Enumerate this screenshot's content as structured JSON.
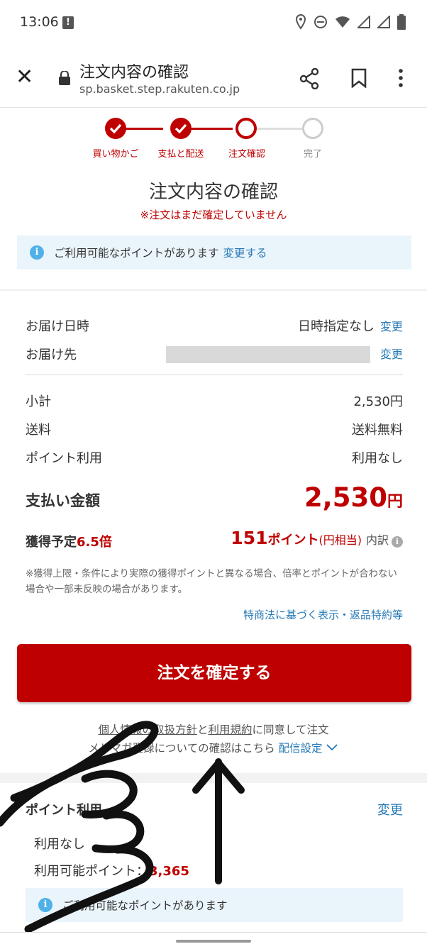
{
  "status_bar": {
    "time": "13:06"
  },
  "browser": {
    "title": "注文内容の確認",
    "url": "sp.basket.step.rakuten.co.jp"
  },
  "steps": [
    {
      "label": "買い物かご",
      "state": "done"
    },
    {
      "label": "支払と配送",
      "state": "done"
    },
    {
      "label": "注文確認",
      "state": "current"
    },
    {
      "label": "完了",
      "state": "todo"
    }
  ],
  "heading": "注文内容の確認",
  "warning": "※注文はまだ確定していません",
  "points_notice": {
    "text": "ご利用可能なポイントがあります",
    "link": "変更する"
  },
  "delivery": {
    "date_label": "お届け日時",
    "date_value": "日時指定なし",
    "date_change": "変更",
    "address_label": "お届け先",
    "address_change": "変更"
  },
  "summary": {
    "subtotal_label": "小計",
    "subtotal_value": "2,530円",
    "shipping_label": "送料",
    "shipping_value": "送料無料",
    "points_label": "ポイント利用",
    "points_value": "利用なし"
  },
  "total": {
    "label": "支払い金額",
    "amount": "2,530",
    "unit": "円"
  },
  "earn": {
    "label": "獲得予定",
    "multiplier": "6.5倍",
    "points": "151",
    "points_unit": "ポイント",
    "equiv": "(円相当)",
    "breakdown": "内訳"
  },
  "note": "※獲得上限・条件により実際の獲得ポイントと異なる場合、倍率とポイントが合わない場合や一部未反映の場合があります。",
  "law_link": "特商法に基づく表示・返品特約等",
  "confirm_button": "注文を確定する",
  "agreement": {
    "privacy": "個人情報の取扱方針",
    "and": "と",
    "terms": "利用規約",
    "suffix": "に同意して注文",
    "line2": "メルマガ登録についての確認はこちら",
    "delivery_settings": "配信設定"
  },
  "point_usage": {
    "title": "ポイント利用",
    "change": "変更",
    "current": "利用なし",
    "available_label": "利用可能ポイント：",
    "available_value": "3,365",
    "notice": "ご利用可能なポイントがあります"
  },
  "colors": {
    "accent": "#bf0000",
    "link": "#2478b5",
    "info_bg": "#eaf4fb"
  }
}
